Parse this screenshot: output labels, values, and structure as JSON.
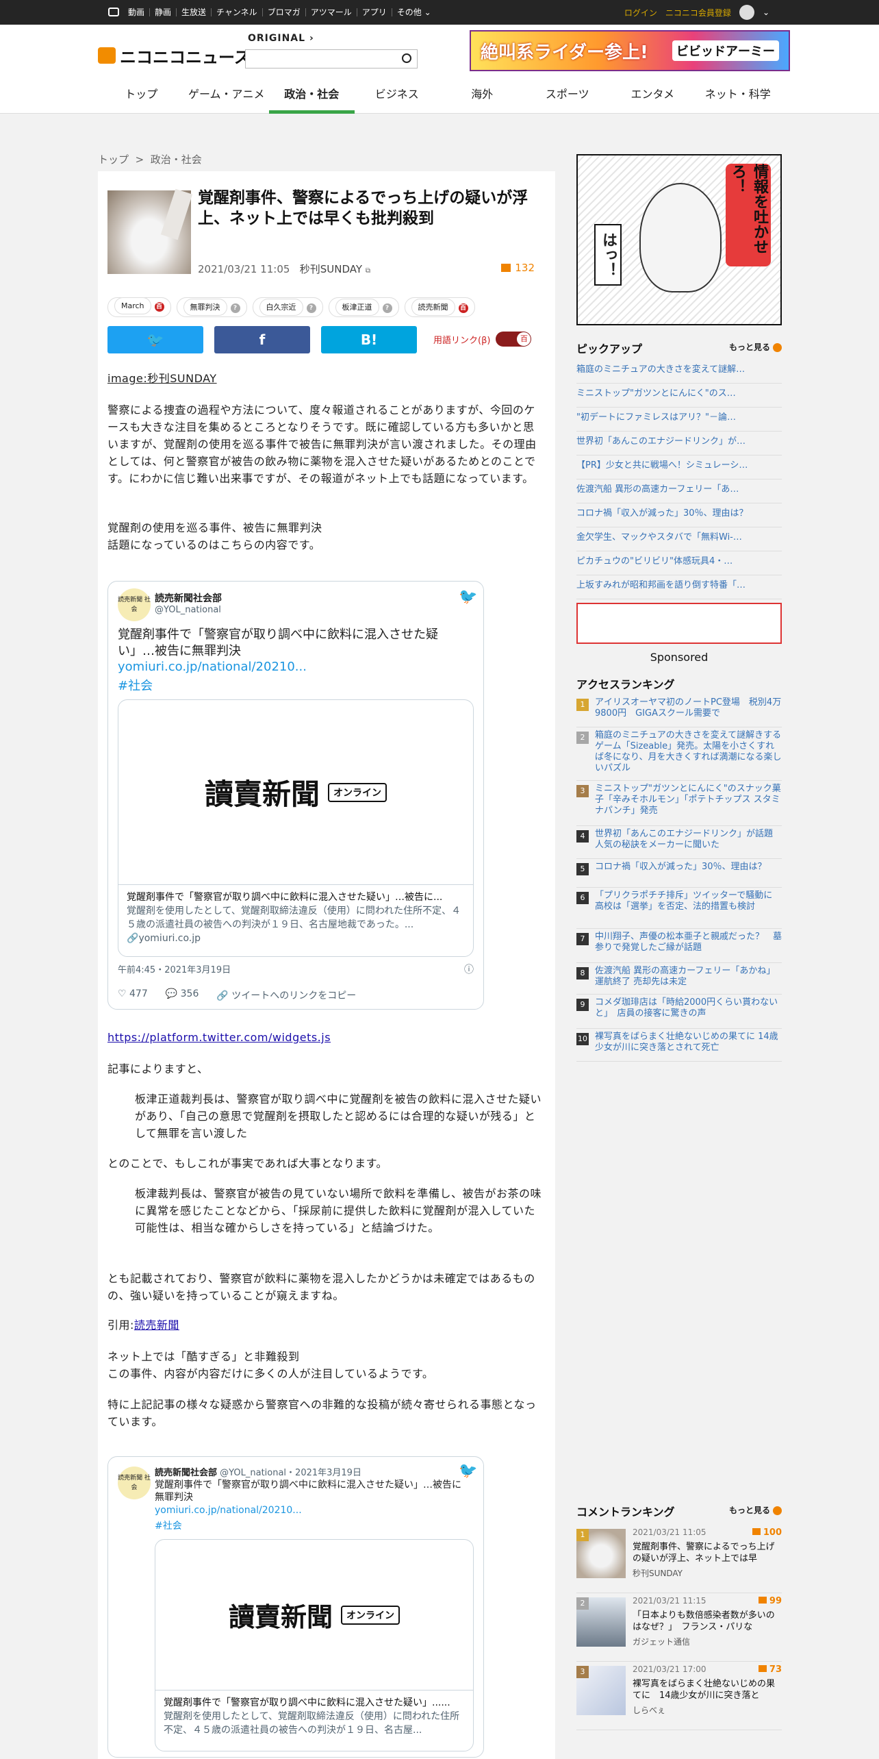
{
  "topbar": {
    "nav": [
      "動画",
      "静画",
      "生放送",
      "チャンネル",
      "ブロマガ",
      "アツマール",
      "アプリ",
      "その他"
    ],
    "login": "ログイン",
    "register": "ニコニコ会員登録"
  },
  "header": {
    "logo": "ニコニコニュース",
    "original": "ORIGINAL",
    "search_value": "",
    "banner_text": "絶叫系ライダー参上!",
    "banner_badge": "ビビッドアーミー",
    "nav": [
      "トップ",
      "ゲーム・アニメ",
      "政治・社会",
      "ビジネス",
      "海外",
      "スポーツ",
      "エンタメ",
      "ネット・科学"
    ],
    "active_nav": "政治・社会"
  },
  "breadcrumb": {
    "home": "トップ",
    "sep": ">",
    "current": "政治・社会"
  },
  "article": {
    "title": "覚醒剤事件、警察によるでっち上げの疑いが浮上、ネット上では早くも批判殺到",
    "datetime": "2021/03/21 11:05",
    "source": "秒刊SUNDAY",
    "comment_count": "132",
    "tags": [
      {
        "label": "March",
        "badge": "百",
        "red": true
      },
      {
        "label": "無罪判決",
        "badge": "?",
        "red": false
      },
      {
        "label": "白久宗近",
        "badge": "?",
        "red": false
      },
      {
        "label": "板津正道",
        "badge": "?",
        "red": false
      },
      {
        "label": "読売新聞",
        "badge": "百",
        "red": true
      }
    ],
    "share": {
      "twitter": "🐦",
      "facebook": "f",
      "hatena": "B!"
    },
    "glossary_label": "用語リンク(β)",
    "image_credit": "image:秒刊SUNDAY",
    "p1": "警察による捜査の過程や方法について、度々報道されることがありますが、今回のケースも大きな注目を集めるところとなりそうです。既に確認している方も多いかと思いますが、覚醒剤の使用を巡る事件で被告に無罪判決が言い渡されました。その理由としては、何と警察官が被告の飲み物に薬物を混入させた疑いがあるためとのことです。にわかに信じ難い出来事ですが、その報道がネット上でも話題になっています。",
    "p2a": "覚醒剤の使用を巡る事件、被告に無罪判決",
    "p2b": "話題になっているのはこちらの内容です。",
    "widget_link": "https://platform.twitter.com/widgets.js",
    "p3": "記事によりますと、",
    "q1": "板津正道裁判長は、警察官が取り調べ中に覚醒剤を被告の飲料に混入させた疑いがあり、「自己の意思で覚醒剤を摂取したと認めるには合理的な疑いが残る」として無罪を言い渡した",
    "p4": "とのことで、もしこれが事実であれば大事となります。",
    "q2": "板津裁判長は、警察官が被告の見ていない場所で飲料を準備し、被告がお茶の味に異常を感じたことなどから、「採尿前に提供した飲料に覚醒剤が混入していた可能性は、相当な確からしさを持っている」と結論づけた。",
    "p5": "とも記載されており、警察官が飲料に薬物を混入したかどうかは未確定ではあるものの、強い疑いを持っていることが窺えますね。",
    "cite_label": "引用:",
    "cite_link": "読売新聞",
    "p6a": "ネット上では「酷すぎる」と非難殺到",
    "p6b": "この事件、内容が内容だけに多くの人が注目しているようです。",
    "p7": "特に上記記事の様々な疑惑から警察官への非難的な投稿が続々寄せられる事態となっています。"
  },
  "tweet1": {
    "avatar": "読売新聞 社会",
    "name": "読売新聞社会部",
    "handle": "@YOL_national",
    "text": "覚醒剤事件で「警察官が取り調べ中に飲料に混入させた疑い」…被告に無罪判決",
    "link": "yomiuri.co.jp/national/20210...",
    "hashtag": "#社会",
    "card_logo": "讀賣新聞",
    "card_badge": "オンライン",
    "card_title": "覚醒剤事件で「警察官が取り調べ中に飲料に混入させた疑い」…被告に...",
    "card_desc": "覚醒剤を使用したとして、覚醒剤取締法違反（使用）に問われた住所不定、４５歳の派遣社員の被告への判決が１９日、名古屋地裁であった。...",
    "card_domain": "yomiuri.co.jp",
    "time": "午前4:45・2021年3月19日",
    "likes": "477",
    "replies": "356",
    "copy": "ツイートへのリンクをコピー"
  },
  "tweet2": {
    "avatar": "読売新聞 社会",
    "name": "読売新聞社会部",
    "handle": "@YOL_national・2021年3月19日",
    "text": "覚醒剤事件で「警察官が取り調べ中に飲料に混入させた疑い」…被告に無罪判決",
    "link": "yomiuri.co.jp/national/20210...",
    "hashtag": "#社会",
    "card_logo": "讀賣新聞",
    "card_badge": "オンライン",
    "card_title": "覚醒剤事件で「警察官が取り調べ中に飲料に混入させた疑い」......",
    "card_desc": "覚醒剤を使用したとして、覚醒剤取締法違反（使用）に問われた住所不定、４５歳の派遣社員の被告への判決が１９日、名古屋..."
  },
  "sidebar": {
    "manga_text1": "情報を吐かせろ！",
    "manga_text2": "はっ！",
    "pickup_title": "ピックアップ",
    "more": "もっと見る",
    "pickup": [
      "箱庭のミニチュアの大きさを変えて謎解…",
      "ミニストップ\"ガツンとにんにく\"のス…",
      "\"初デートにファミレスはアリ？\"－論…",
      "世界初「あんこのエナジードリンク」が…",
      "【PR】少女と共に戦場へ！シミュレーシ…",
      "佐渡汽船 異形の高速カーフェリー「あ…",
      "コロナ禍「収入が減った」30％、理由は？",
      "金欠学生、マックやスタバで「無料Wi-…",
      "ピカチュウの\"ビリビリ\"体感玩具4・…",
      "上坂すみれが昭和邦画を語り倒す特番「…"
    ],
    "sponsored": "Sponsored",
    "access_title": "アクセスランキング",
    "access": [
      "アイリスオーヤマ初のノートPC登場　税別4万9800円　GIGAスクール需要で",
      "箱庭のミニチュアの大きさを変えて謎解きするゲーム「Sizeable」発売。太陽を小さくすれば冬になり、月を大きくすれば満潮になる楽しいパズル",
      "ミニストップ\"ガツンとにんにく\"のスナック菓子「辛みそホルモン」「ポテトチップス スタミナパンチ」発売",
      "世界初「あんこのエナジードリンク」が話題　人気の秘訣をメーカーに聞いた",
      "コロナ禍「収入が減った」30％、理由は？",
      "「プリクラポチチ排斥」ツイッターで騒動に　高校は「選挙」を否定、法的措置も検討",
      "中川翔子、声優の松本亜子と親戚だった？　墓参りで発覚したご縁が話題",
      "佐渡汽船 異形の高速カーフェリー「あかね」運航終了 売却先は未定",
      "コメダ珈琲店は「時給2000円くらい貰わないと」　店員の接客に驚きの声",
      "裸写真をばらまく壮絶ないじめの果てに 14歳少女が川に突き落とされて死亡"
    ],
    "comment_title": "コメントランキング",
    "comment": [
      {
        "date": "2021/03/21 11:05",
        "count": "100",
        "title": "覚醒剤事件、警察によるでっち上げの疑いが浮上、ネット上では早",
        "source": "秒刊SUNDAY"
      },
      {
        "date": "2021/03/21 11:15",
        "count": "99",
        "title": "「日本よりも数倍感染者数が多いのはなぜ？」　フランス・パリな",
        "source": "ガジェット通信"
      },
      {
        "date": "2021/03/21 17:00",
        "count": "73",
        "title": "裸写真をばらまく壮絶ないじめの果てに　14歳少女が川に突き落と",
        "source": "しらべぇ"
      }
    ]
  },
  "colors": {
    "accent": "#39a548",
    "orange": "#f08300",
    "twitter": "#1da1f2",
    "facebook": "#3b5998",
    "hatena": "#00a4de",
    "link": "#3571b6"
  }
}
